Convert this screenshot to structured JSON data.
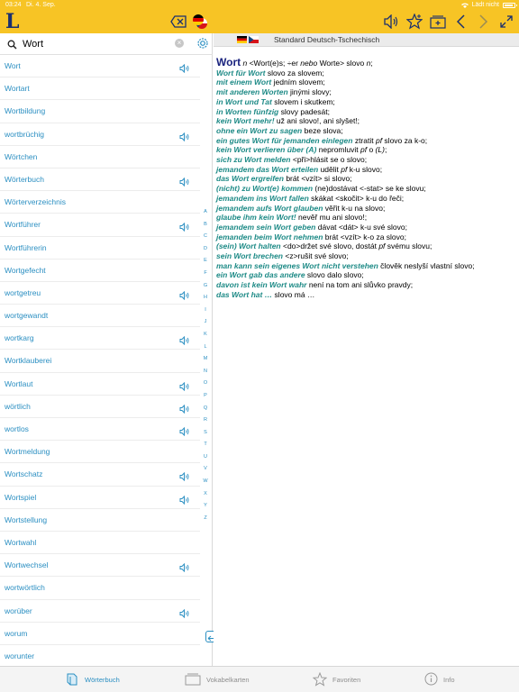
{
  "status": {
    "time": "03:24",
    "date": "Di. 4. Sep.",
    "charging": "Lädt nicht"
  },
  "app": {
    "logo": "L"
  },
  "search": {
    "value": "Wort",
    "placeholder": ""
  },
  "dictionary": {
    "title": "Standard Deutsch-Tschechisch"
  },
  "words": [
    {
      "word": "Wort",
      "audio": true
    },
    {
      "word": "Wortart",
      "audio": false
    },
    {
      "word": "Wortbildung",
      "audio": false
    },
    {
      "word": "wortbrüchig",
      "audio": true
    },
    {
      "word": "Wörtchen",
      "audio": false
    },
    {
      "word": "Wörterbuch",
      "audio": true
    },
    {
      "word": "Wörterverzeichnis",
      "audio": false
    },
    {
      "word": "Wortführer",
      "audio": true
    },
    {
      "word": "Wortführerin",
      "audio": false
    },
    {
      "word": "Wortgefecht",
      "audio": false
    },
    {
      "word": "wortgetreu",
      "audio": true
    },
    {
      "word": "wortgewandt",
      "audio": false
    },
    {
      "word": "wortkarg",
      "audio": true
    },
    {
      "word": "Wortklauberei",
      "audio": false
    },
    {
      "word": "Wortlaut",
      "audio": true
    },
    {
      "word": "wörtlich",
      "audio": true
    },
    {
      "word": "wortlos",
      "audio": true
    },
    {
      "word": "Wortmeldung",
      "audio": false
    },
    {
      "word": "Wortschatz",
      "audio": true
    },
    {
      "word": "Wortspiel",
      "audio": true
    },
    {
      "word": "Wortstellung",
      "audio": false
    },
    {
      "word": "Wortwahl",
      "audio": false
    },
    {
      "word": "Wortwechsel",
      "audio": true
    },
    {
      "word": "wortwörtlich",
      "audio": false
    },
    {
      "word": "worüber",
      "audio": true
    },
    {
      "word": "worum",
      "audio": false
    },
    {
      "word": "worunter",
      "audio": false
    }
  ],
  "alphabet": [
    "A",
    "B",
    "C",
    "D",
    "E",
    "F",
    "G",
    "H",
    "I",
    "J",
    "K",
    "L",
    "M",
    "N",
    "O",
    "P",
    "Q",
    "R",
    "S",
    "T",
    "U",
    "V",
    "W",
    "X",
    "Y",
    "Z"
  ],
  "entry": {
    "headword": "Wort",
    "lines": [
      [
        {
          "t": "n",
          "s": "gram"
        },
        {
          "t": " <Wort(e)s; ÷er "
        },
        {
          "t": "nebo",
          "s": "gram"
        },
        {
          "t": " Worte> slovo "
        },
        {
          "t": "n",
          "s": "gram"
        },
        {
          "t": ";"
        }
      ],
      [
        {
          "t": "Wort für Wort",
          "s": "phr"
        },
        {
          "t": " slovo za slovem;"
        }
      ],
      [
        {
          "t": "mit einem Wort",
          "s": "phr"
        },
        {
          "t": " jedním slovem;"
        }
      ],
      [
        {
          "t": "mit anderen Worten",
          "s": "phr"
        },
        {
          "t": " jinými slovy;"
        }
      ],
      [
        {
          "t": "in Wort und Tat",
          "s": "phr"
        },
        {
          "t": " slovem i skutkem;"
        }
      ],
      [
        {
          "t": "in Worten fünfzig",
          "s": "phr"
        },
        {
          "t": " slovy padesát;"
        }
      ],
      [
        {
          "t": "kein Wort mehr!",
          "s": "phr"
        },
        {
          "t": " už ani slovo!, ani slyšet!;"
        }
      ],
      [
        {
          "t": "ohne ein Wort zu sagen",
          "s": "phr"
        },
        {
          "t": " beze slova;"
        }
      ],
      [
        {
          "t": "ein gutes Wort für jemanden einlegen",
          "s": "phr"
        },
        {
          "t": " ztratit "
        },
        {
          "t": "pf",
          "s": "gram"
        },
        {
          "t": " slovo za k-o;"
        }
      ],
      [
        {
          "t": "kein Wort verlieren über (A)",
          "s": "phr"
        },
        {
          "t": " nepromluvit "
        },
        {
          "t": "pf",
          "s": "gram"
        },
        {
          "t": " o "
        },
        {
          "t": "(L)",
          "s": "gram"
        },
        {
          "t": ";"
        }
      ],
      [
        {
          "t": "sich zu Wort melden",
          "s": "phr"
        },
        {
          "t": " <při>hlásit se o slovo;"
        }
      ],
      [
        {
          "t": "jemandem das Wort erteilen",
          "s": "phr"
        },
        {
          "t": " udělit "
        },
        {
          "t": "pf",
          "s": "gram"
        },
        {
          "t": " k-u slovo;"
        }
      ],
      [
        {
          "t": "das Wort ergreifen",
          "s": "phr"
        },
        {
          "t": " brát <vzít> si slovo;"
        }
      ],
      [
        {
          "t": "(nicht) zu Wort(e) kommen",
          "s": "phr"
        },
        {
          "t": " (ne)dostávat <-stat> se ke slovu;"
        }
      ],
      [
        {
          "t": "jemandem ins Wort fallen",
          "s": "phr"
        },
        {
          "t": " skákat <skočit> k-u do řeči;"
        }
      ],
      [
        {
          "t": "jemandem aufs Wort glauben",
          "s": "phr"
        },
        {
          "t": " věřit k-u na slovo;"
        }
      ],
      [
        {
          "t": "glaube ihm kein Wort!",
          "s": "phr"
        },
        {
          "t": " nevěř mu ani slovo!;"
        }
      ],
      [
        {
          "t": "jemandem sein Wort geben",
          "s": "phr"
        },
        {
          "t": " dávat <dát> k-u své slovo;"
        }
      ],
      [
        {
          "t": "jemanden beim Wort nehmen",
          "s": "phr"
        },
        {
          "t": " brát <vzít> k-o za slovo;"
        }
      ],
      [
        {
          "t": "(sein) Wort halten",
          "s": "phr"
        },
        {
          "t": " <do>držet své slovo, dostát "
        },
        {
          "t": "pf",
          "s": "gram"
        },
        {
          "t": " svému slovu;"
        }
      ],
      [
        {
          "t": "sein Wort brechen",
          "s": "phr"
        },
        {
          "t": " <z>rušit své slovo;"
        }
      ],
      [
        {
          "t": "man kann sein eigenes Wort nicht verstehen",
          "s": "phr"
        },
        {
          "t": " člověk neslyší vlastní slovo;"
        }
      ],
      [
        {
          "t": "ein Wort gab das andere",
          "s": "phr"
        },
        {
          "t": " slovo dalo slovo;"
        }
      ],
      [
        {
          "t": "davon ist kein Wort wahr",
          "s": "phr"
        },
        {
          "t": " není na tom ani slůvko pravdy;"
        }
      ],
      [
        {
          "t": "das Wort hat …",
          "s": "phr"
        },
        {
          "t": " slovo má …"
        }
      ]
    ]
  },
  "tabs": [
    {
      "label": "Wörterbuch",
      "active": true,
      "icon": "book-icon"
    },
    {
      "label": "Vokabelkarten",
      "active": false,
      "icon": "flashcards-icon"
    },
    {
      "label": "Favoriten",
      "active": false,
      "icon": "star-icon"
    },
    {
      "label": "Info",
      "active": false,
      "icon": "info-icon"
    }
  ],
  "colors": {
    "toolbar": "#f7c425",
    "brand": "#1a2f6f",
    "link": "#2b8fc2",
    "phrase": "#1d8a86",
    "headword": "#1a237e"
  }
}
